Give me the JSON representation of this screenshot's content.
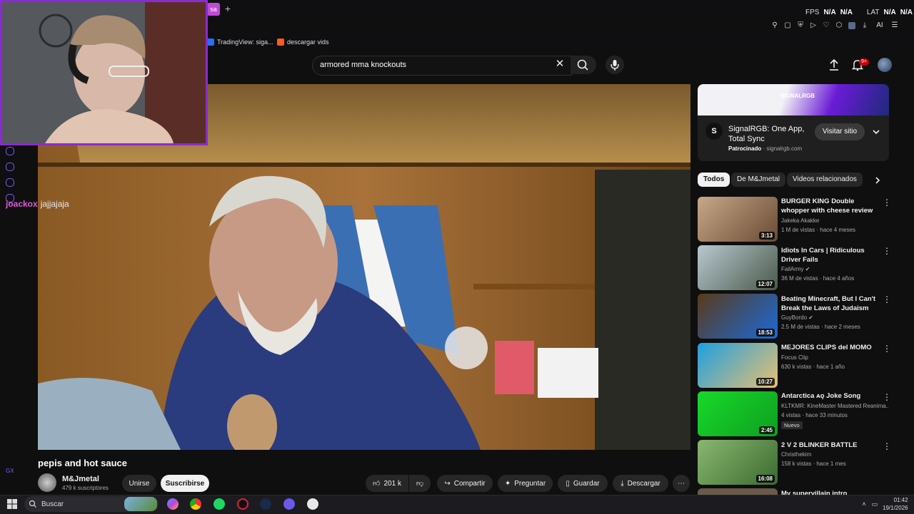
{
  "browser": {
    "tab_label": "sa",
    "new_tab": "+",
    "bookmarks": [
      {
        "label": "TradingView: siga...",
        "color": "#2a6ef2"
      },
      {
        "label": "descargar vids",
        "color": "#ff5a1f"
      }
    ],
    "overlay": {
      "fps_label": "FPS",
      "fps_value": "N/A",
      "fps_value2": "N/A",
      "lat_label": "LAT",
      "lat_value": "N/A",
      "lat_value2": "N/A"
    },
    "toolbar_ai_label": "AI"
  },
  "masthead": {
    "search_value": "armored mma knockouts",
    "notifications_badge": "9+"
  },
  "stream_overlay": {
    "chat_user": "joackox",
    "chat_message": "jajjajaja",
    "gx_label": "GX"
  },
  "video": {
    "title": "pepis and hot sauce",
    "channel": "M&Jmetal",
    "subscribers": "479 k suscriptores",
    "join_label": "Unirse",
    "subscribe_label": "Suscribirse",
    "likes": "201 k",
    "share_label": "Compartir",
    "ask_label": "Preguntar",
    "save_label": "Guardar",
    "download_label": "Descargar"
  },
  "ad": {
    "logo_text": "SIGNALRGB",
    "icon_letter": "S",
    "title": "SignalRGB: One App, Total Sync",
    "sponsored_label": "Patrocinado",
    "domain": "· signalrgb.com",
    "cta_label": "Visitar sitio"
  },
  "chips": [
    "Todos",
    "De M&Jmetal",
    "Videos relacionados"
  ],
  "recommendations": [
    {
      "title": "BURGER KING Double whopper with cheese review",
      "channel": "Jakeka Akakke",
      "verified": false,
      "meta": "1 M de vistas · hace 4 meses",
      "duration": "3:13",
      "badge": ""
    },
    {
      "title": "Idiots In Cars | Ridiculous Driver Fails",
      "channel": "FailArmy",
      "verified": true,
      "meta": "36 M de vistas · hace 4 años",
      "duration": "12:07",
      "badge": ""
    },
    {
      "title": "Beating Minecraft, But I Can't Break the Laws of Judaism",
      "channel": "GuyBordo",
      "verified": true,
      "meta": "2.5 M de vistas · hace 2 meses",
      "duration": "18:53",
      "badge": ""
    },
    {
      "title": "MEJORES CLIPS del MOMO",
      "channel": "Focus Clip",
      "verified": false,
      "meta": "630 k vistas · hace 1 año",
      "duration": "10:27",
      "badge": ""
    },
    {
      "title": "Antarctica ᴀǫ Joke Song",
      "channel": "KLTKMR: KineMaster Mastered Reanima...",
      "verified": false,
      "meta": "4 vistas · hace 33 minutos",
      "duration": "2:45",
      "badge": "Nuevo"
    },
    {
      "title": "2 V 2 BLINKER BATTLE",
      "channel": "Christhekim",
      "verified": false,
      "meta": "158 k vistas · hace 1 mes",
      "duration": "16:08",
      "badge": ""
    },
    {
      "title": "My supervillain intro",
      "channel": "",
      "verified": false,
      "meta": "",
      "duration": "",
      "badge": ""
    }
  ],
  "taskbar": {
    "search_placeholder": "Buscar",
    "time": "01:42",
    "date": "19/1/2026"
  }
}
